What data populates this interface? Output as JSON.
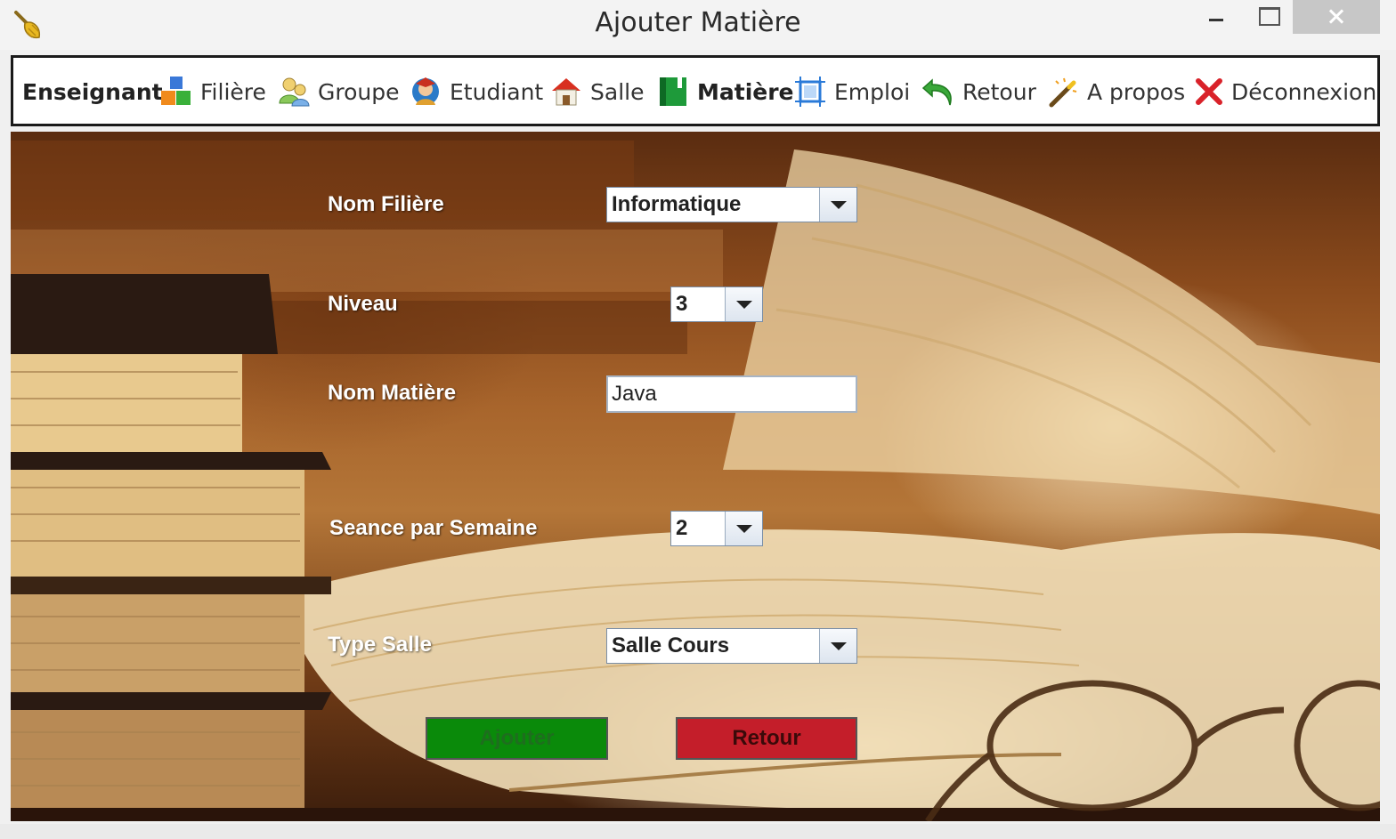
{
  "window": {
    "title": "Ajouter Matière",
    "app_icon": "broom-icon"
  },
  "menu": {
    "items": [
      {
        "label": "Enseignant",
        "icon": ""
      },
      {
        "label": "Filière",
        "icon": "blocks-icon"
      },
      {
        "label": "Groupe",
        "icon": "people-icon"
      },
      {
        "label": "Etudiant",
        "icon": "student-icon"
      },
      {
        "label": "Salle",
        "icon": "house-icon"
      },
      {
        "label": "Matière",
        "icon": "book-icon"
      },
      {
        "label": "Emploi",
        "icon": "frame-icon"
      },
      {
        "label": "Retour",
        "icon": "undo-arrow-icon"
      },
      {
        "label": "A propos",
        "icon": "magic-wand-icon"
      },
      {
        "label": "Déconnexion",
        "icon": "red-x-icon"
      }
    ]
  },
  "form": {
    "nom_filiere": {
      "label": "Nom Filière",
      "value": "Informatique"
    },
    "niveau": {
      "label": "Niveau",
      "value": "3"
    },
    "nom_matiere": {
      "label": "Nom Matière",
      "value": "Java"
    },
    "seance": {
      "label": "Seance par Semaine",
      "value": "2"
    },
    "type_salle": {
      "label": "Type Salle",
      "value": "Salle Cours"
    }
  },
  "buttons": {
    "ajouter": "Ajouter",
    "retour": "Retour"
  },
  "colors": {
    "ajouter_bg": "#0a8a0a",
    "retour_bg": "#c41e2a",
    "deconnexion_icon": "#d9222a"
  }
}
